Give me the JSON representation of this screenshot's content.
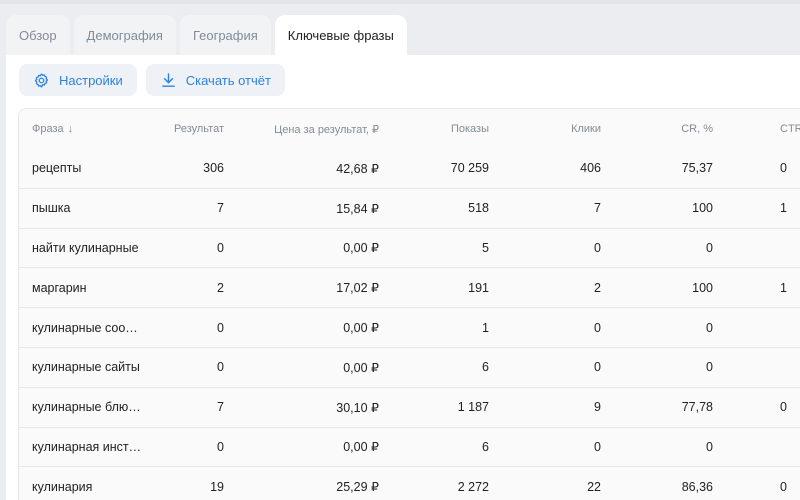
{
  "tabs": [
    {
      "label": "Обзор",
      "active": false
    },
    {
      "label": "Демография",
      "active": false
    },
    {
      "label": "География",
      "active": false
    },
    {
      "label": "Ключевые фразы",
      "active": true
    }
  ],
  "toolbar": {
    "settings_label": "Настройки",
    "settings_icon": "gear-icon",
    "download_label": "Скачать отчёт",
    "download_icon": "download-icon"
  },
  "table": {
    "columns": [
      "Фраза",
      "Результат",
      "Цена за результат, ₽",
      "Показы",
      "Клики",
      "CR, %",
      "CTR"
    ],
    "sort_indicator": "↓",
    "rows": [
      [
        "рецепты",
        "306",
        "42,68 ₽",
        "70 259",
        "406",
        "75,37",
        "0"
      ],
      [
        "пышка",
        "7",
        "15,84 ₽",
        "518",
        "7",
        "100",
        "1"
      ],
      [
        "найти кулинарные",
        "0",
        "0,00 ₽",
        "5",
        "0",
        "0",
        ""
      ],
      [
        "маргарин",
        "2",
        "17,02 ₽",
        "191",
        "2",
        "100",
        "1"
      ],
      [
        "кулинарные соо…",
        "0",
        "0,00 ₽",
        "1",
        "0",
        "0",
        ""
      ],
      [
        "кулинарные сайты",
        "0",
        "0,00 ₽",
        "6",
        "0",
        "0",
        ""
      ],
      [
        "кулинарные блю…",
        "7",
        "30,10 ₽",
        "1 187",
        "9",
        "77,78",
        "0"
      ],
      [
        "кулинарная инст…",
        "0",
        "0,00 ₽",
        "6",
        "0",
        "0",
        ""
      ],
      [
        "кулинария",
        "19",
        "25,29 ₽",
        "2 272",
        "22",
        "86,36",
        "0"
      ]
    ]
  },
  "colors": {
    "accent": "#2d81e0",
    "muted_text": "#818c99",
    "panel_bg": "#ffffff",
    "page_bg": "#ebedf0"
  }
}
